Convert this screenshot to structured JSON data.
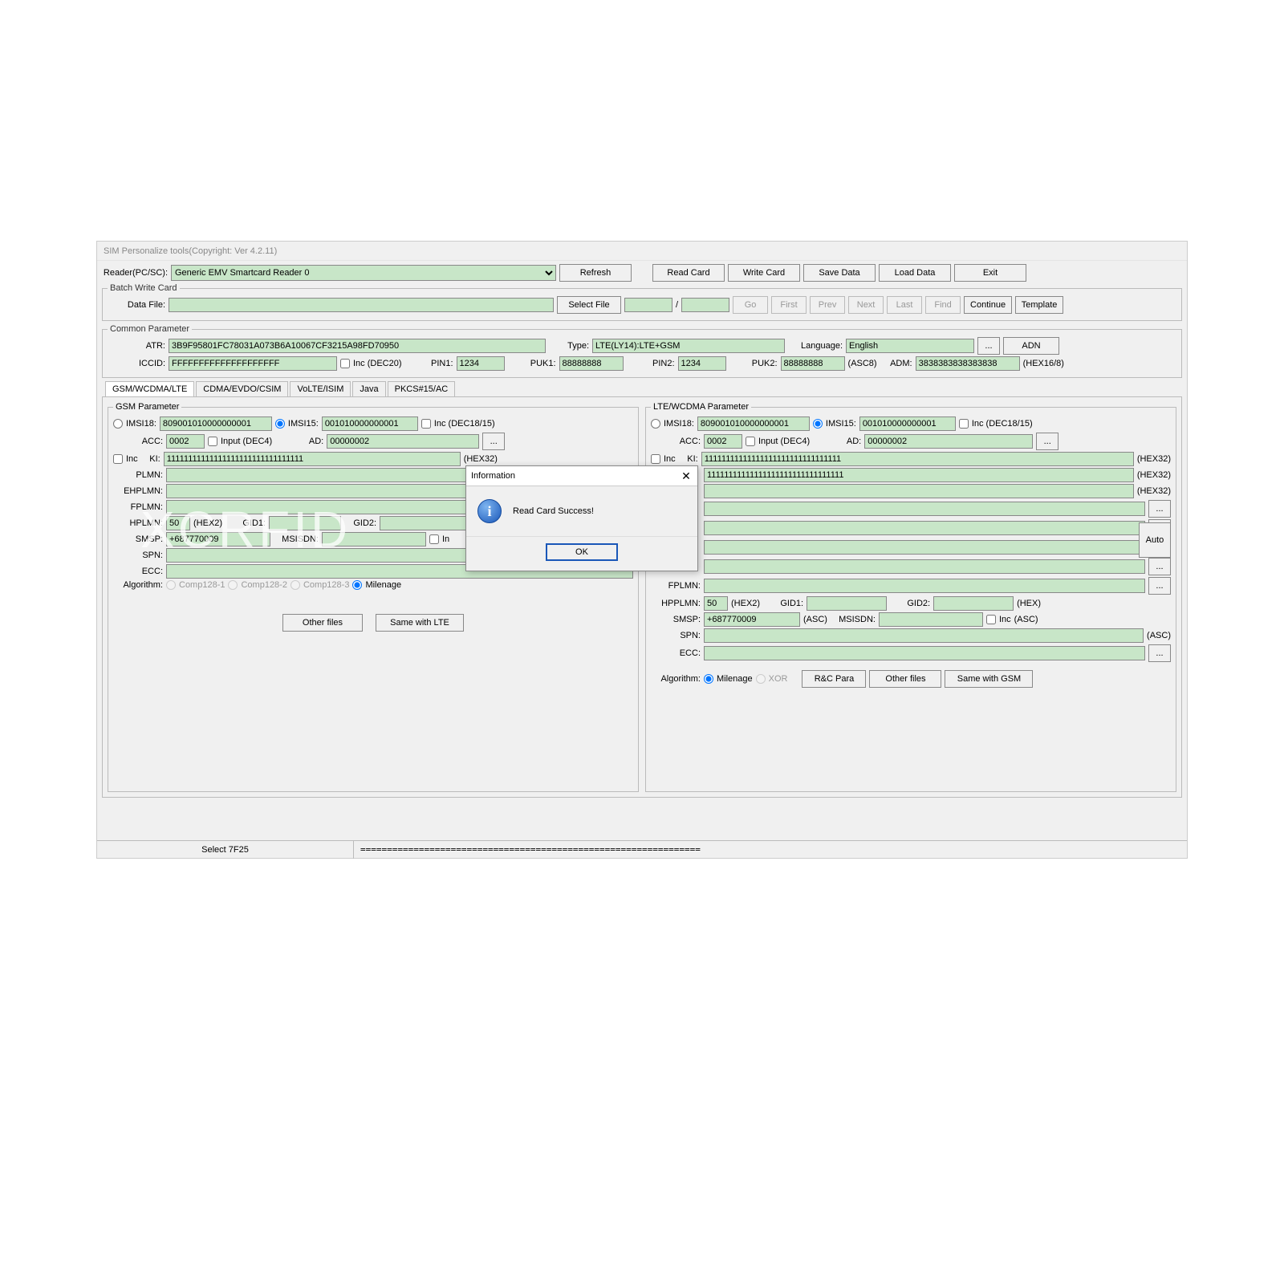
{
  "title": "SIM Personalize tools(Copyright: Ver 4.2.11)",
  "toolbar": {
    "reader_label": "Reader(PC/SC):",
    "reader_value": "Generic EMV Smartcard Reader 0",
    "refresh": "Refresh",
    "read_card": "Read Card",
    "write_card": "Write Card",
    "save_data": "Save Data",
    "load_data": "Load Data",
    "exit": "Exit"
  },
  "batch": {
    "legend": "Batch Write Card",
    "data_file_label": "Data File:",
    "data_file": "",
    "select_file": "Select File",
    "idx": "",
    "total": "",
    "go": "Go",
    "first": "First",
    "prev": "Prev",
    "next": "Next",
    "last": "Last",
    "find": "Find",
    "continue": "Continue",
    "template": "Template"
  },
  "common": {
    "legend": "Common Parameter",
    "atr_label": "ATR:",
    "atr": "3B9F95801FC78031A073B6A10067CF3215A98FD70950",
    "type_label": "Type:",
    "type": "LTE(LY14):LTE+GSM",
    "language_label": "Language:",
    "language": "English",
    "adn": "ADN",
    "iccid_label": "ICCID:",
    "iccid": "FFFFFFFFFFFFFFFFFFFF",
    "iccid_inc": "Inc  (DEC20)",
    "pin1_label": "PIN1:",
    "pin1": "1234",
    "puk1_label": "PUK1:",
    "puk1": "88888888",
    "pin2_label": "PIN2:",
    "pin2": "1234",
    "puk2_label": "PUK2:",
    "puk2": "88888888",
    "puk2_suffix": "(ASC8)",
    "adm_label": "ADM:",
    "adm": "3838383838383838",
    "adm_suffix": "(HEX16/8)"
  },
  "tabs": [
    "GSM/WCDMA/LTE",
    "CDMA/EVDO/CSIM",
    "VoLTE/ISIM",
    "Java",
    "PKCS#15/AC"
  ],
  "gsm": {
    "legend": "GSM Parameter",
    "imsi18_label": "IMSI18:",
    "imsi18": "809001010000000001",
    "imsi15_label": "IMSI15:",
    "imsi15": "001010000000001",
    "inc_label": "Inc  (DEC18/15)",
    "acc_label": "ACC:",
    "acc": "0002",
    "input_label": "Input (DEC4)",
    "ad_label": "AD:",
    "ad": "00000002",
    "ki_inc": "Inc",
    "ki_label": "KI:",
    "ki": "11111111111111111111111111111111",
    "ki_suffix": "(HEX32)",
    "plmn_label": "PLMN:",
    "plmn": "",
    "ehplmn_label": "EHPLMN:",
    "ehplmn": "",
    "fplmn_label": "FPLMN:",
    "fplmn": "",
    "hplmn_label": "HPLMN:",
    "hplmn": "50",
    "hplmn_suffix": "(HEX2)",
    "gid1_label": "GID1:",
    "gid1": "",
    "gid2_label": "GID2:",
    "gid2": "",
    "smsp_label": "SMSP:",
    "smsp": "+687770009",
    "msisdn_label": "MSISDN:",
    "msisdn": "",
    "spn_label": "SPN:",
    "spn": "",
    "ecc_label": "ECC:",
    "ecc": "",
    "algo_label": "Algorithm:",
    "algo_opts": [
      "Comp128-1",
      "Comp128-2",
      "Comp128-3",
      "Milenage"
    ],
    "other_files": "Other files",
    "same_with_lte": "Same with LTE"
  },
  "lte": {
    "legend": "LTE/WCDMA Parameter",
    "imsi18_label": "IMSI18:",
    "imsi18": "809001010000000001",
    "imsi15_label": "IMSI15:",
    "imsi15": "001010000000001",
    "inc_label": "Inc  (DEC18/15)",
    "acc_label": "ACC:",
    "acc": "0002",
    "input_label": "Input (DEC4)",
    "ad_label": "AD:",
    "ad": "00000002",
    "ki_inc": "Inc",
    "ki_label": "KI:",
    "ki": "11111111111111111111111111111111",
    "ki_suffix": "(HEX32)",
    "row4_val": "11111111111111111111111111111111",
    "row4_suffix": "(HEX32)",
    "row5_suffix": "(HEX32)",
    "fplmn_label": "FPLMN:",
    "hpplmn_label": "HPPLMN:",
    "hpplmn": "50",
    "hpplmn_suffix": "(HEX2)",
    "gid1_label": "GID1:",
    "gid2_label": "GID2:",
    "gid_suffix": "(HEX)",
    "smsp_label": "SMSP:",
    "smsp": "+687770009",
    "smsp_suffix": "(ASC)",
    "msisdn_label": "MSISDN:",
    "msisdn_inc": "Inc",
    "msisdn_suffix": "(ASC)",
    "spn_label": "SPN:",
    "spn_suffix": "(ASC)",
    "ecc_label": "ECC:",
    "algo_label": "Algorithm:",
    "algo_opts": [
      "Milenage",
      "XOR"
    ],
    "rc_para": "R&C Para",
    "other_files": "Other files",
    "same_with_gsm": "Same with GSM",
    "auto": "Auto"
  },
  "dialog": {
    "title": "Information",
    "message": "Read Card Success!",
    "ok": "OK"
  },
  "status": {
    "left": "Select 7F25",
    "right": "================================================================"
  },
  "misc": {
    "dots": "...",
    "slash": "/"
  }
}
